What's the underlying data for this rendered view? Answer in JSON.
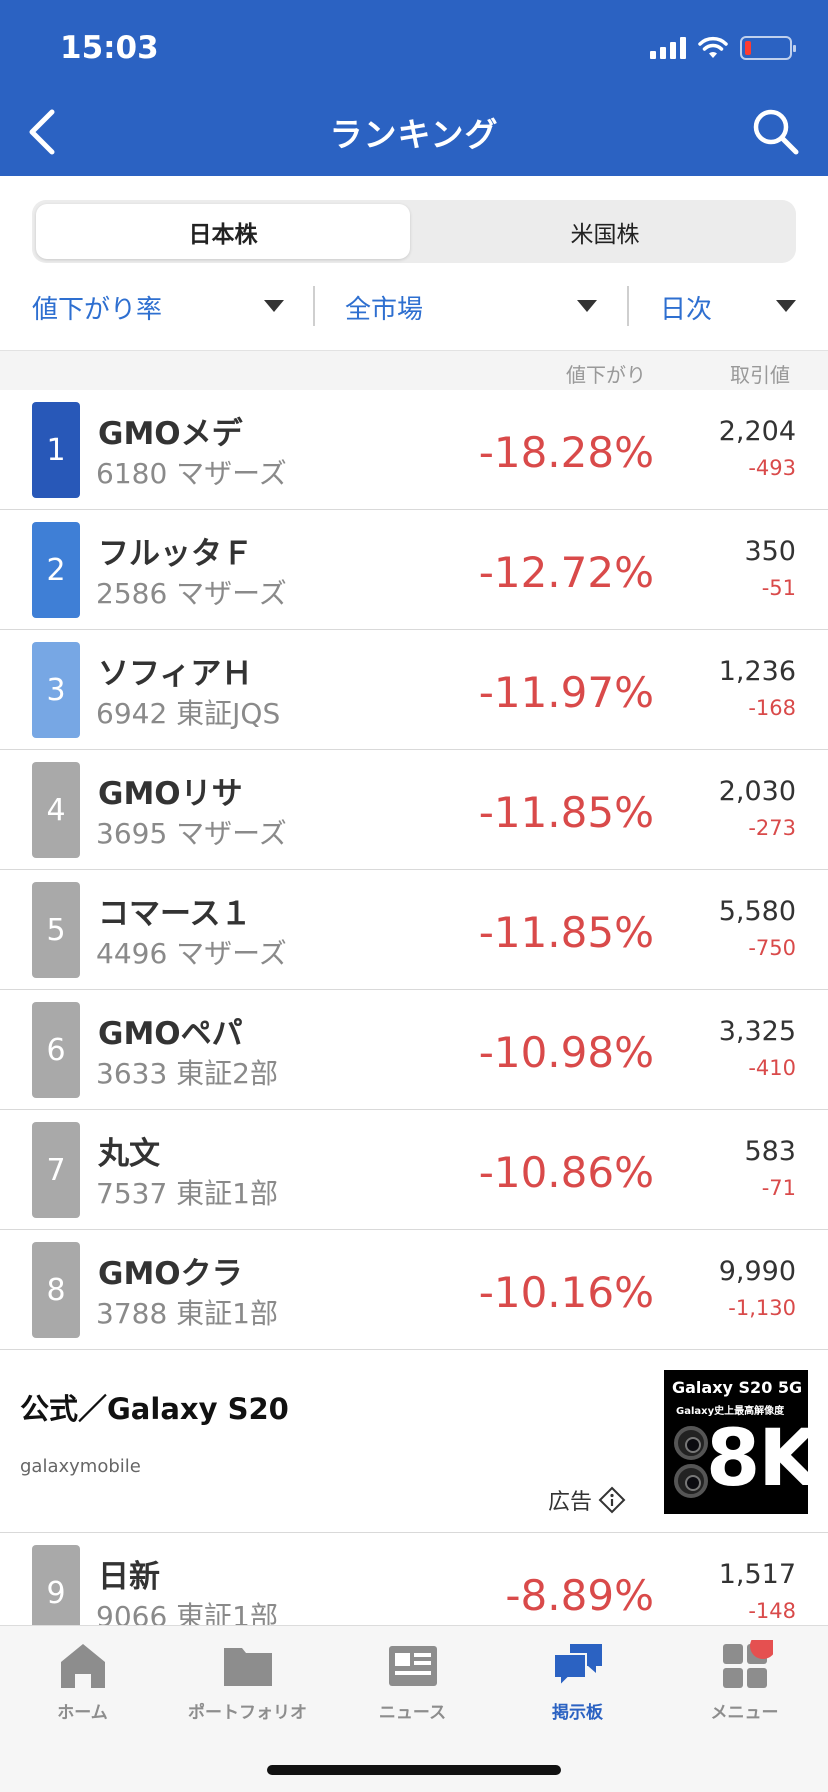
{
  "status": {
    "time": "15:03"
  },
  "nav": {
    "title": "ランキング",
    "back_icon": "chevron-left-icon",
    "search_icon": "search-icon"
  },
  "segment": {
    "active": "日本株",
    "inactive": "米国株"
  },
  "filters": {
    "sort": "値下がり率",
    "market": "全市場",
    "period": "日次"
  },
  "columns": {
    "change_pct": "値下がり",
    "trade_price": "取引値"
  },
  "rank_colors": {
    "1": "#2858b8",
    "2": "#3f7fd6",
    "3": "#77a7e4",
    "other": "#a9a9a9"
  },
  "rows": [
    {
      "rank": "1",
      "name": "GMOメデ",
      "code": "6180 マザーズ",
      "pct": "-18.28%",
      "price": "2,204",
      "change": "-493"
    },
    {
      "rank": "2",
      "name": "フルッタＦ",
      "code": "2586 マザーズ",
      "pct": "-12.72%",
      "price": "350",
      "change": "-51"
    },
    {
      "rank": "3",
      "name": "ソフィアＨ",
      "code": "6942 東証JQS",
      "pct": "-11.97%",
      "price": "1,236",
      "change": "-168"
    },
    {
      "rank": "4",
      "name": "GMOリサ",
      "code": "3695 マザーズ",
      "pct": "-11.85%",
      "price": "2,030",
      "change": "-273"
    },
    {
      "rank": "5",
      "name": "コマース１",
      "code": "4496 マザーズ",
      "pct": "-11.85%",
      "price": "5,580",
      "change": "-750"
    },
    {
      "rank": "6",
      "name": "GMOペパ",
      "code": "3633 東証2部",
      "pct": "-10.98%",
      "price": "3,325",
      "change": "-410"
    },
    {
      "rank": "7",
      "name": "丸文",
      "code": "7537 東証1部",
      "pct": "-10.86%",
      "price": "583",
      "change": "-71"
    },
    {
      "rank": "8",
      "name": "GMOクラ",
      "code": "3788 東証1部",
      "pct": "-10.16%",
      "price": "9,990",
      "change": "-1,130"
    }
  ],
  "ad": {
    "title": "公式／Galaxy S20",
    "source": "galaxymobile",
    "label": "広告",
    "image_line1": "Galaxy S20 5G",
    "image_line2": "Galaxy史上最高解像度",
    "image_big": "8K"
  },
  "row9": {
    "rank": "9",
    "name": "日新",
    "code": "9066 東証1部",
    "pct": "-8.89%",
    "price": "1,517",
    "change": "-148"
  },
  "tabs": [
    {
      "label": "ホーム",
      "icon": "home-icon"
    },
    {
      "label": "ポートフォリオ",
      "icon": "folder-icon"
    },
    {
      "label": "ニュース",
      "icon": "newspaper-icon"
    },
    {
      "label": "掲示板",
      "icon": "chat-bubbles-icon",
      "active": true
    },
    {
      "label": "メニュー",
      "icon": "grid-menu-icon",
      "badge": true
    }
  ]
}
